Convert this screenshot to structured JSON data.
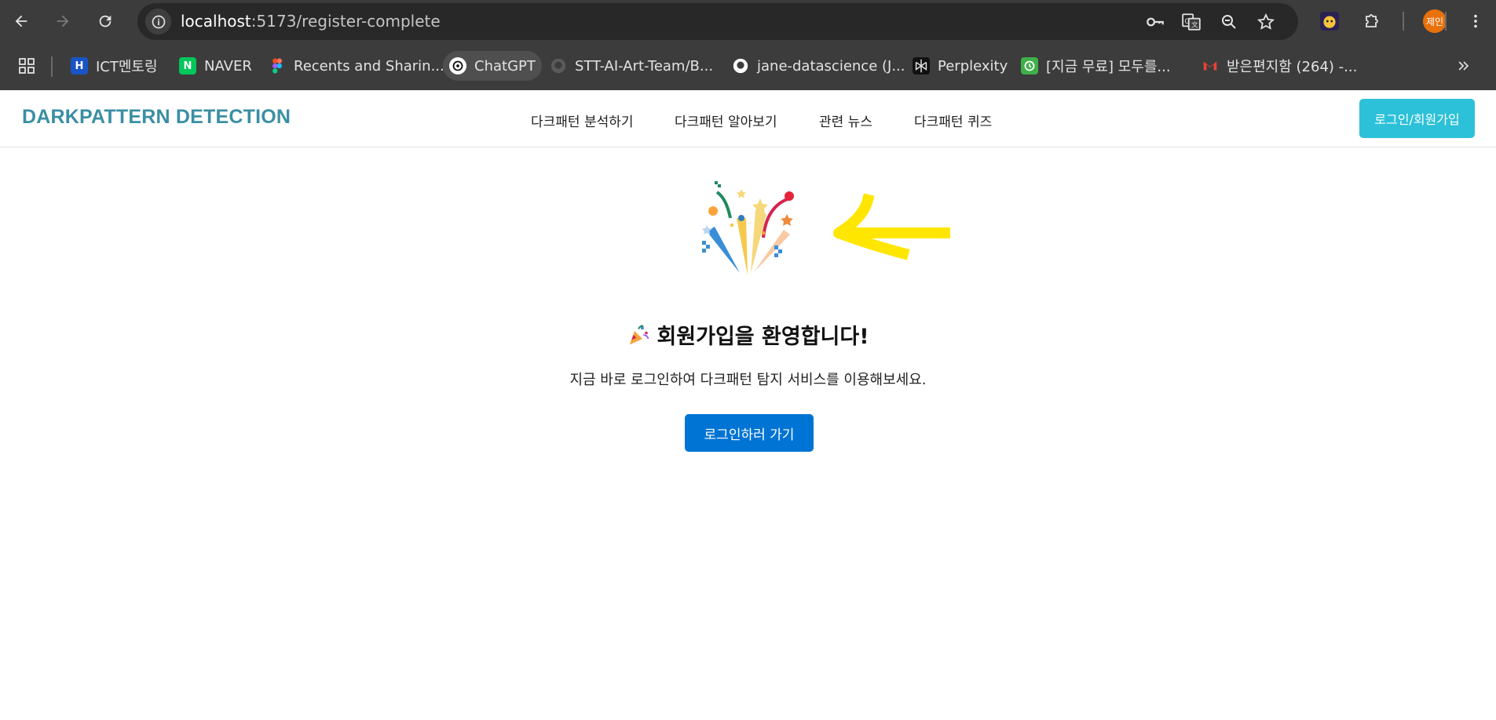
{
  "browser": {
    "url_host": "localhost",
    "url_path": ":5173/register-complete",
    "profile_label": "제인",
    "bookmarks": [
      {
        "label": "ICT멘토링",
        "icon": "H"
      },
      {
        "label": "NAVER",
        "icon": "N"
      },
      {
        "label": "Recents and Sharin...",
        "icon": "figma-icon"
      },
      {
        "label": "ChatGPT",
        "icon": "chatgpt-icon"
      },
      {
        "label": "STT-AI-Art-Team/B...",
        "icon": "github-icon"
      },
      {
        "label": "jane-datascience (J...",
        "icon": "github-icon"
      },
      {
        "label": "Perplexity",
        "icon": "perplexity-icon"
      },
      {
        "label": "[지금 무료] 모두를...",
        "icon": "clock-icon"
      },
      {
        "label": "받은편지함 (264) -...",
        "icon": "gmail-icon"
      }
    ]
  },
  "site": {
    "logo": "DARKPATTERN DETECTION",
    "menu": [
      "다크패턴 분석하기",
      "다크패턴 알아보기",
      "관련 뉴스",
      "다크패턴 퀴즈"
    ],
    "login_button": "로그인/회원가입"
  },
  "main": {
    "title": "회원가입을 환영합니다!",
    "subtitle": "지금 바로 로그인하여 다크패턴 탐지 서비스를 이용해보세요.",
    "cta": "로그인하러 가기"
  },
  "colors": {
    "accent": "#2cc1d8",
    "primary": "#0074d4",
    "logo": "#3a8fa3",
    "annotation": "#ffe600"
  }
}
